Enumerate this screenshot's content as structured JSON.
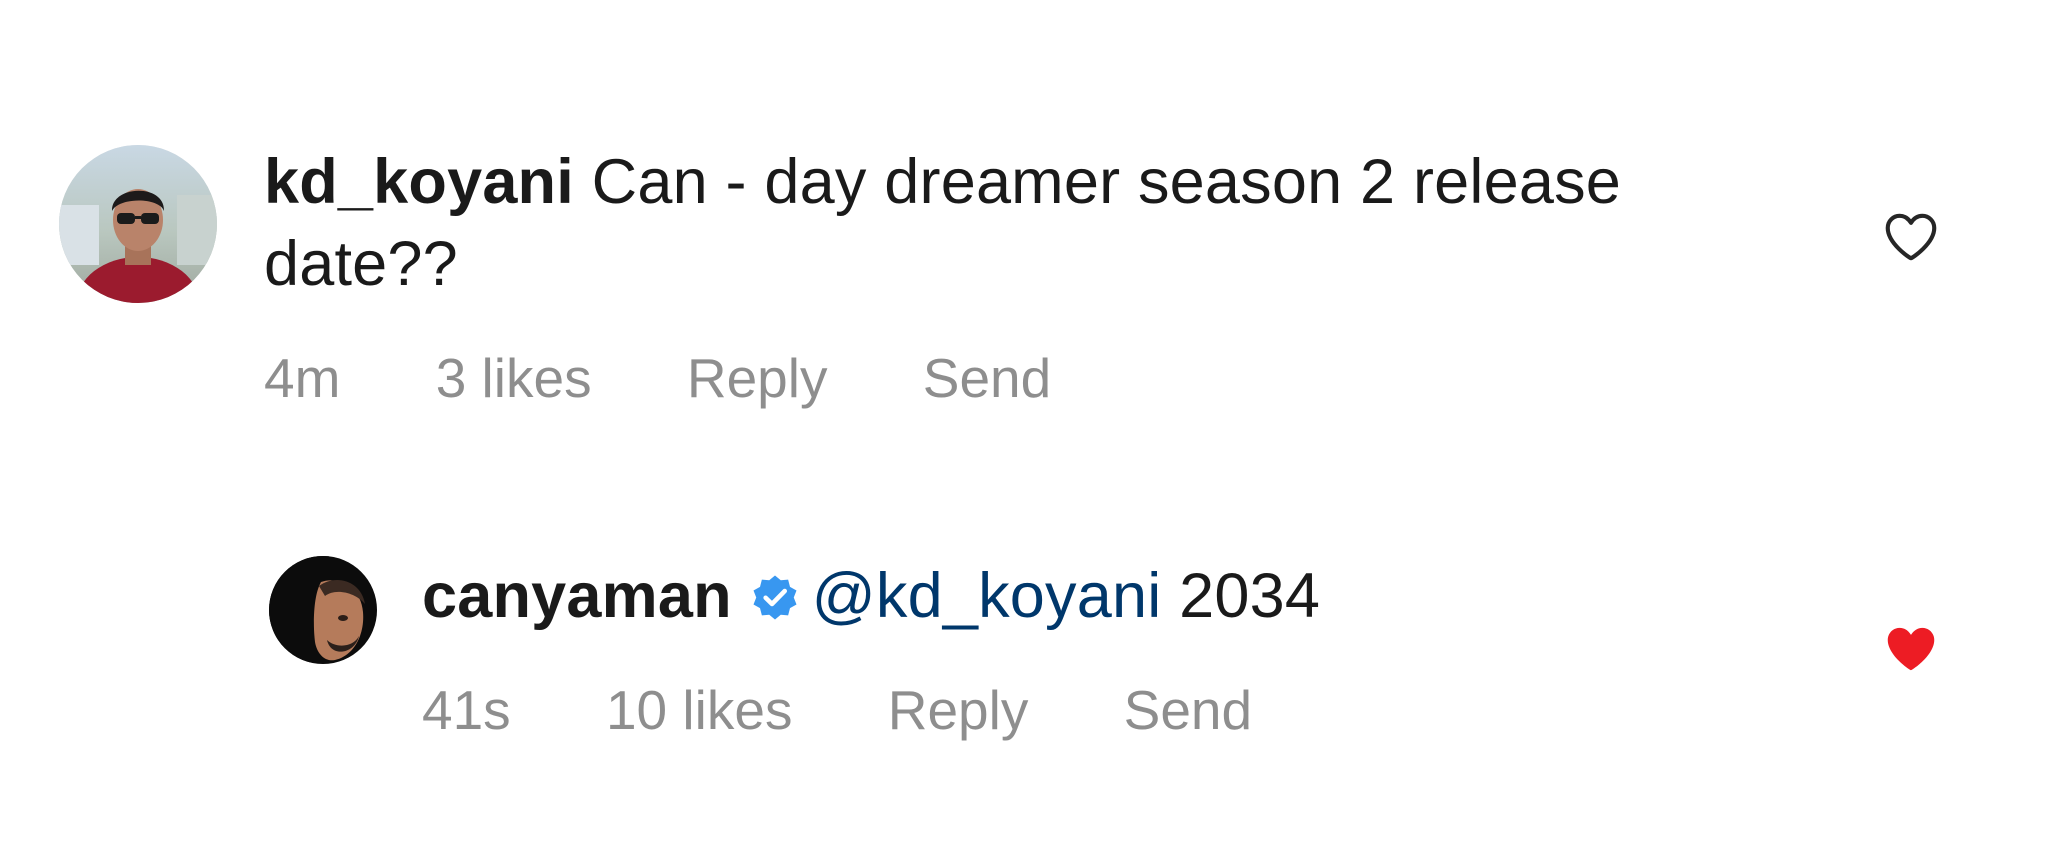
{
  "comments": [
    {
      "username": "kd_koyani",
      "text": " Can - day dreamer season 2 release date??",
      "time": "4m",
      "likes": "3 likes",
      "reply_label": "Reply",
      "send_label": "Send",
      "liked": false,
      "avatar_icon": "profile-photo"
    },
    {
      "username": "canyaman",
      "verified": true,
      "mention": "@kd_koyani",
      "text": " 2034",
      "time": "41s",
      "likes": "10 likes",
      "reply_label": "Reply",
      "send_label": "Send",
      "liked": true,
      "avatar_icon": "profile-photo"
    }
  ],
  "colors": {
    "username": "#1a1a1a",
    "mention": "#00376b",
    "meta": "#8e8e8e",
    "verified": "#3897f0",
    "liked_heart": "#ed1c24",
    "unliked_heart": "#262626"
  }
}
